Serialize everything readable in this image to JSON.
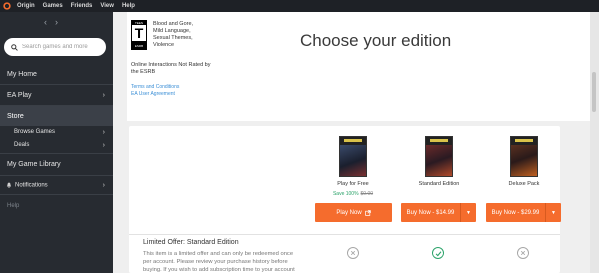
{
  "menubar": {
    "items": [
      "Origin",
      "Games",
      "Friends",
      "View",
      "Help"
    ],
    "brand_color": "#f56c2d"
  },
  "sidebar": {
    "nav_back": "‹",
    "nav_forward": "›",
    "search_placeholder": "Search games and more",
    "items": {
      "my_home": "My Home",
      "ea_play": "EA Play",
      "store": "Store",
      "browse_games": "Browse Games",
      "deals": "Deals",
      "my_game_library": "My Game Library",
      "notifications": "Notifications",
      "help": "Help"
    }
  },
  "rating": {
    "esrb_top": "TEEN",
    "esrb_letter": "T",
    "esrb_bottom": "ESRB",
    "descriptors": [
      "Blood and Gore,",
      "Mild Language,",
      "Sexual Themes,",
      "Violence"
    ],
    "online_note": "Online Interactions Not Rated by the ESRB",
    "links": [
      "Terms and Conditions",
      "EA User Agreement"
    ]
  },
  "page": {
    "title": "Choose your edition"
  },
  "editions": [
    {
      "label": "Play for Free",
      "save": "Save 100%",
      "old_price": "$0.00",
      "button": "Play Now",
      "button_icon": "external-link-icon"
    },
    {
      "label": "Standard Edition",
      "button": "Buy Now - $14.99",
      "button_icon": "chevron-down-icon"
    },
    {
      "label": "Deluxe Pack",
      "button": "Buy Now - $29.99",
      "button_icon": "chevron-down-icon"
    }
  ],
  "offer": {
    "title": "Limited Offer: Standard Edition",
    "text": "This item is a limited offer and can only be redeemed once per account. Please review your purchase history before buying. If you wish to add subscription time to your account",
    "marks": [
      "x",
      "check",
      "x"
    ]
  },
  "colors": {
    "accent": "#f56c2d",
    "success": "#2ca36a",
    "link": "#3b8fd6",
    "sidebar_bg": "#272b31"
  }
}
